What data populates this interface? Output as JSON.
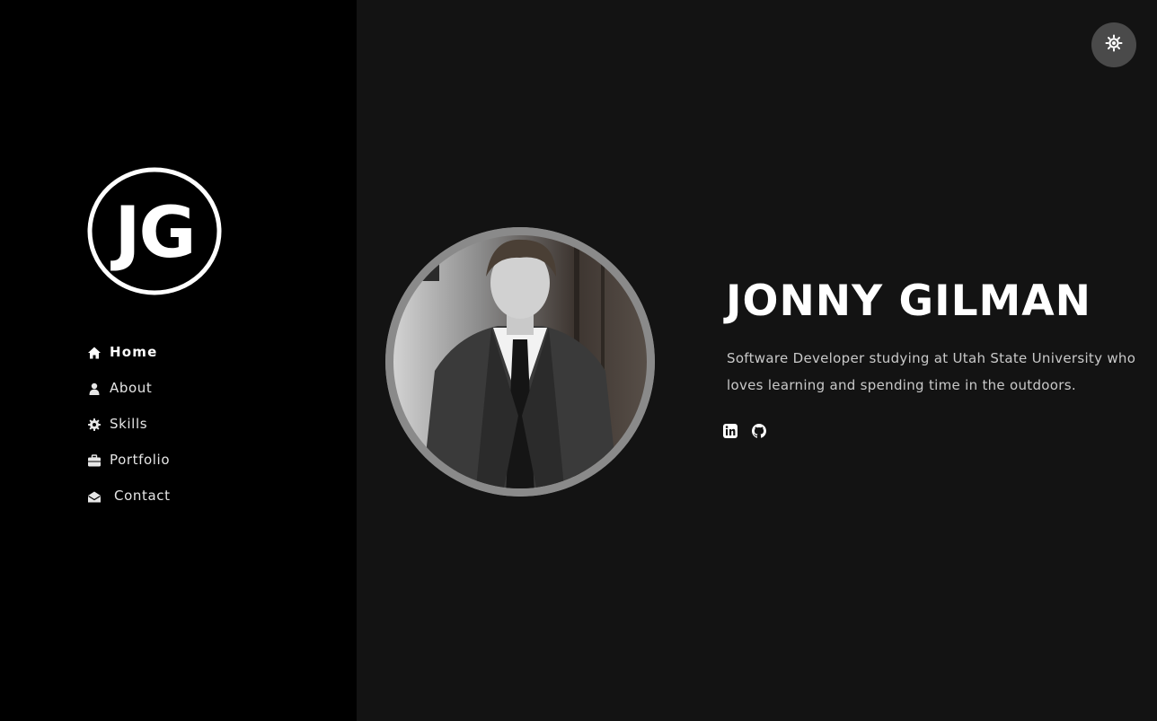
{
  "logo": {
    "monogram": "JG"
  },
  "nav": {
    "items": [
      {
        "label": "Home",
        "icon": "home-icon",
        "active": true
      },
      {
        "label": "About",
        "icon": "user-icon",
        "active": false
      },
      {
        "label": "Skills",
        "icon": "gear-icon",
        "active": false
      },
      {
        "label": "Portfolio",
        "icon": "briefcase-icon",
        "active": false
      },
      {
        "label": "Contact",
        "icon": "envelope-open-icon",
        "active": false
      }
    ]
  },
  "theme_toggle": {
    "icon": "sun-icon"
  },
  "hero": {
    "name": "JONNY GILMAN",
    "description": "Software Developer studying at Utah State University who loves learning and spending time in the outdoors.",
    "social": [
      {
        "icon": "linkedin-icon"
      },
      {
        "icon": "github-icon"
      }
    ]
  },
  "colors": {
    "sidebar_bg": "#000000",
    "main_bg": "#131313",
    "text": "#ffffff",
    "muted_text": "#c9c9c9",
    "toggle_bg": "#4a4a4a"
  }
}
